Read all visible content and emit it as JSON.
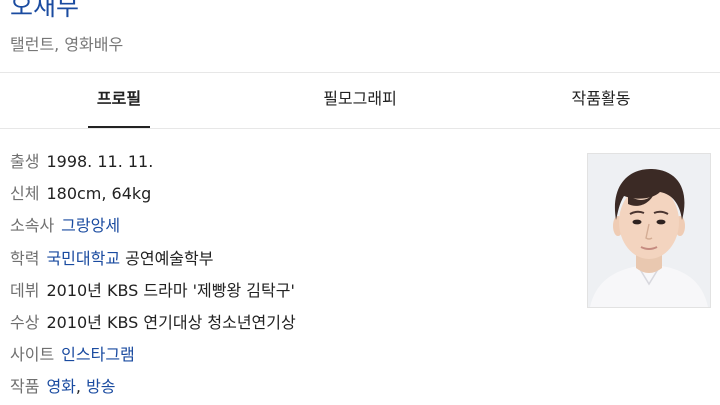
{
  "header": {
    "name": "오재무",
    "subtitle": "탤런트, 영화배우"
  },
  "tabs": [
    {
      "label": "프로필",
      "active": true
    },
    {
      "label": "필모그래피",
      "active": false
    },
    {
      "label": "작품활동",
      "active": false
    }
  ],
  "profile": {
    "birth": {
      "label": "출생",
      "value": "1998. 11. 11."
    },
    "body": {
      "label": "신체",
      "value": "180cm, 64kg"
    },
    "agency": {
      "label": "소속사",
      "link": "그랑앙세"
    },
    "education": {
      "label": "학력",
      "link": "국민대학교",
      "suffix": " 공연예술학부"
    },
    "debut": {
      "label": "데뷔",
      "value": "2010년 KBS 드라마 '제빵왕 김탁구'"
    },
    "award": {
      "label": "수상",
      "value": "2010년 KBS 연기대상 청소년연기상"
    },
    "site": {
      "label": "사이트",
      "link": "인스타그램"
    },
    "works": {
      "label": "작품",
      "link1": "영화",
      "sep": ", ",
      "link2": "방송"
    }
  },
  "colors": {
    "link": "#1a4ba0",
    "label": "#707070",
    "text": "#222222",
    "subtitle": "#777777"
  },
  "icons": {
    "photo": "profile-photo"
  }
}
